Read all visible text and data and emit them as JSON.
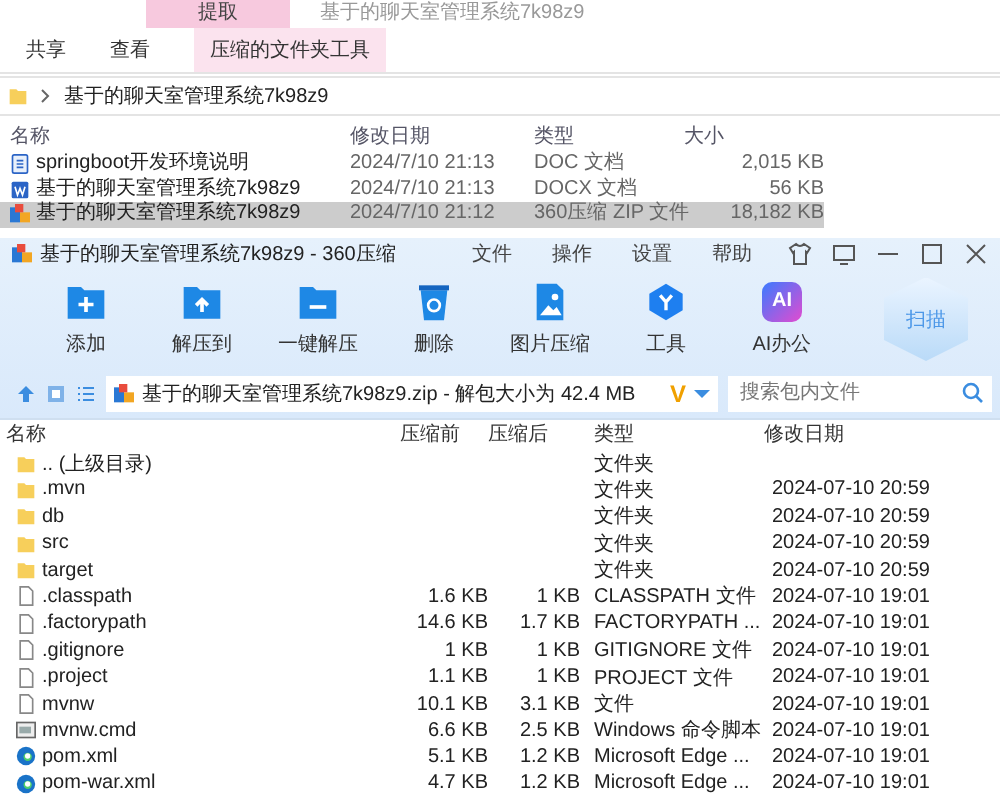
{
  "explorer": {
    "context_tab": "提取",
    "window_title": "基于的聊天室管理系统7k98z9",
    "ribbon_tabs": [
      {
        "label": "共享",
        "selected": false
      },
      {
        "label": "查看",
        "selected": false
      },
      {
        "label": "压缩的文件夹工具",
        "selected": true
      }
    ],
    "breadcrumb": "基于的聊天室管理系统7k98z9",
    "columns": [
      "名称",
      "修改日期",
      "类型",
      "大小"
    ],
    "rows": [
      {
        "kind": "doc",
        "name": "springboot开发环境说明",
        "date": "2024/7/10 21:13",
        "type": "DOC 文档",
        "size": "2,015 KB",
        "selected": false
      },
      {
        "kind": "docx",
        "name": "基于的聊天室管理系统7k98z9",
        "date": "2024/7/10 21:13",
        "type": "DOCX 文档",
        "size": "56 KB",
        "selected": false
      },
      {
        "kind": "zip",
        "name": "基于的聊天室管理系统7k98z9",
        "date": "2024/7/10 21:12",
        "type": "360压缩 ZIP 文件",
        "size": "18,182 KB",
        "selected": true
      }
    ]
  },
  "archiver": {
    "title": "基于的聊天室管理系统7k98z9 - 360压缩",
    "menu": [
      "文件",
      "操作",
      "设置",
      "帮助"
    ],
    "tools": [
      {
        "kind": "add",
        "label": "添加"
      },
      {
        "kind": "extract",
        "label": "解压到"
      },
      {
        "kind": "oneclick",
        "label": "一键解压"
      },
      {
        "kind": "delete",
        "label": "删除"
      },
      {
        "kind": "image",
        "label": "图片压缩"
      },
      {
        "kind": "tools",
        "label": "工具"
      },
      {
        "kind": "ai",
        "label": "AI办公",
        "badge": "AI"
      }
    ],
    "scan": "扫描",
    "path_badge": "V",
    "path": "基于的聊天室管理系统7k98z9.zip - 解包大小为 42.4 MB",
    "search": {
      "placeholder": "搜索包内文件"
    },
    "columns": [
      "名称",
      "压缩前",
      "压缩后",
      "类型",
      "修改日期"
    ],
    "rows": [
      {
        "kind": "folder",
        "name": ".. (上级目录)",
        "type": "文件夹"
      },
      {
        "kind": "folder",
        "name": ".mvn",
        "type": "文件夹",
        "date": "2024-07-10 20:59"
      },
      {
        "kind": "folder",
        "name": "db",
        "type": "文件夹",
        "date": "2024-07-10 20:59"
      },
      {
        "kind": "folder",
        "name": "src",
        "type": "文件夹",
        "date": "2024-07-10 20:59"
      },
      {
        "kind": "folder",
        "name": "target",
        "type": "文件夹",
        "date": "2024-07-10 20:59"
      },
      {
        "kind": "file",
        "name": ".classpath",
        "before": "1.6 KB",
        "after": "1 KB",
        "type": "CLASSPATH 文件",
        "date": "2024-07-10 19:01"
      },
      {
        "kind": "file",
        "name": ".factorypath",
        "before": "14.6 KB",
        "after": "1.7 KB",
        "type": "FACTORYPATH ...",
        "date": "2024-07-10 19:01"
      },
      {
        "kind": "file",
        "name": ".gitignore",
        "before": "1 KB",
        "after": "1 KB",
        "type": "GITIGNORE 文件",
        "date": "2024-07-10 19:01"
      },
      {
        "kind": "file",
        "name": ".project",
        "before": "1.1 KB",
        "after": "1 KB",
        "type": "PROJECT 文件",
        "date": "2024-07-10 19:01"
      },
      {
        "kind": "file",
        "name": "mvnw",
        "before": "10.1 KB",
        "after": "3.1 KB",
        "type": "文件",
        "date": "2024-07-10 19:01"
      },
      {
        "kind": "cmd",
        "name": "mvnw.cmd",
        "before": "6.6 KB",
        "after": "2.5 KB",
        "type": "Windows 命令脚本",
        "date": "2024-07-10 19:01"
      },
      {
        "kind": "edge",
        "name": "pom.xml",
        "before": "5.1 KB",
        "after": "1.2 KB",
        "type": "Microsoft Edge ...",
        "date": "2024-07-10 19:01"
      },
      {
        "kind": "edge",
        "name": "pom-war.xml",
        "before": "4.7 KB",
        "after": "1.2 KB",
        "type": "Microsoft Edge ...",
        "date": "2024-07-10 19:01"
      }
    ]
  }
}
